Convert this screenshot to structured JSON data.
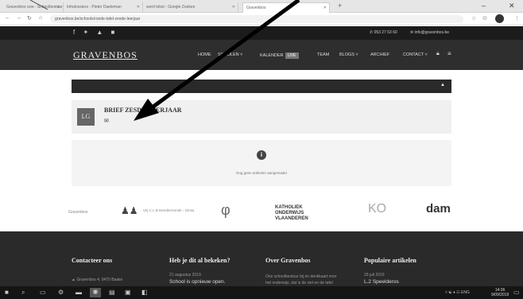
{
  "browser": {
    "tabs": [
      {
        "label": "Gravenbos vzw - Schoolbestuur"
      },
      {
        "label": "Infodossiers - Pieter Daeleman"
      },
      {
        "label": "word tekst - Google Zoeken"
      },
      {
        "label": "Gravenbos"
      }
    ],
    "url": "gravenbos.be/schools/ronde-tafel-zesde-leerjaar"
  },
  "site": {
    "phone": "✆ 053 27 63 60",
    "email": "✉ info@gravenbos.be",
    "logo": "GRAVENBOS",
    "nav": [
      {
        "label": "HOME"
      },
      {
        "label": "SCHOLEN ˅"
      },
      {
        "label": "KALENDER"
      },
      {
        "label": "TEAM"
      },
      {
        "label": "BLOGS ˅"
      },
      {
        "label": "ARCHIEF"
      },
      {
        "label": "CONTACT ˅"
      }
    ],
    "nav_badge": "LIVE",
    "social": "f ✦ ▲ ■"
  },
  "content": {
    "section_caret": "▲",
    "brief_avatar": "LG",
    "brief_title": "BRIEF ZESDE LEERJAAR",
    "empty_icon": "i",
    "empty_text": "Nog geen artikelen aangemaakt"
  },
  "partners": [
    "Gravenbos",
    "Vrij C.L.B Dendermonde - Ginsa",
    "φ",
    "KATHOLIEK ONDERWIJS VLAANDEREN",
    "KO",
    "dam"
  ],
  "footer": {
    "columns": [
      {
        "heading": "Contacteer ons",
        "line1": "▲ Gravenbos 4, 9470 Baalei"
      },
      {
        "heading": "Heb je dit al bekeken?",
        "date": "21 augustus 2019",
        "link": "School is opnieuw open."
      },
      {
        "heading": "Over Gravenbos",
        "line1": "Ons schoolbestuur bij en denkkaart voor",
        "line2": "het onderwijs, dat is de ziel en de tafel"
      },
      {
        "heading": "Populaire artikelen",
        "date": "29 juli 2019",
        "link": "L.2 Speelderos"
      }
    ]
  },
  "taskbar": {
    "tray": "˄ ☯ ♦ ☷ ENG",
    "time": "14:36",
    "date": "9/09/2019"
  }
}
